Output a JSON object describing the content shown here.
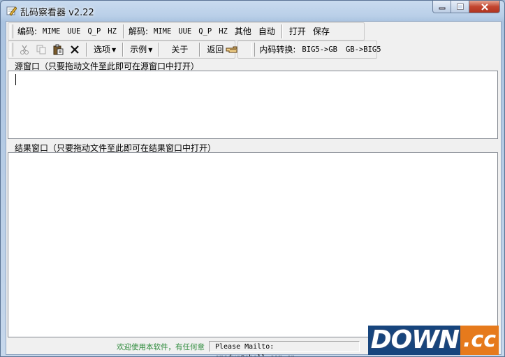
{
  "window": {
    "title": "乱码察看器 v2.22"
  },
  "toolbar1": {
    "encode_label": "编码:",
    "encode_buttons": [
      "MIME",
      "UUE",
      "Q_P",
      "HZ"
    ],
    "decode_label": "解码:",
    "decode_buttons": [
      "MIME",
      "UUE",
      "Q_P",
      "HZ",
      "其他",
      "自动"
    ],
    "file_buttons": [
      "打开",
      "保存"
    ]
  },
  "toolbar2": {
    "options_label": "选项",
    "examples_label": "示例",
    "about_label": "关于",
    "back_label": "返回",
    "convert_label": "内码转换:",
    "convert_buttons": [
      "BIG5->GB",
      "GB->BIG5"
    ]
  },
  "source_pane": {
    "label": "源窗口（只要拖动文件至此即可在源窗口中打开）"
  },
  "result_pane": {
    "label": "结果窗口（只要拖动文件至此即可在结果窗口中打开）"
  },
  "statusbar": {
    "welcome": "欢迎使用本软件，有任何意",
    "mailto": "Please Mailto: smsdxq@sbell.com.cn"
  },
  "watermark": {
    "part1": "DOWN",
    "part2": ".cc"
  },
  "colors": {
    "titlebar": "#b9cfe8",
    "close_button": "#c2452f",
    "status_text": "#2e8b3c"
  },
  "icons": [
    "app-pencil-icon",
    "cut-icon",
    "copy-icon",
    "paste-icon",
    "delete-icon",
    "pointing-hand-icon"
  ]
}
